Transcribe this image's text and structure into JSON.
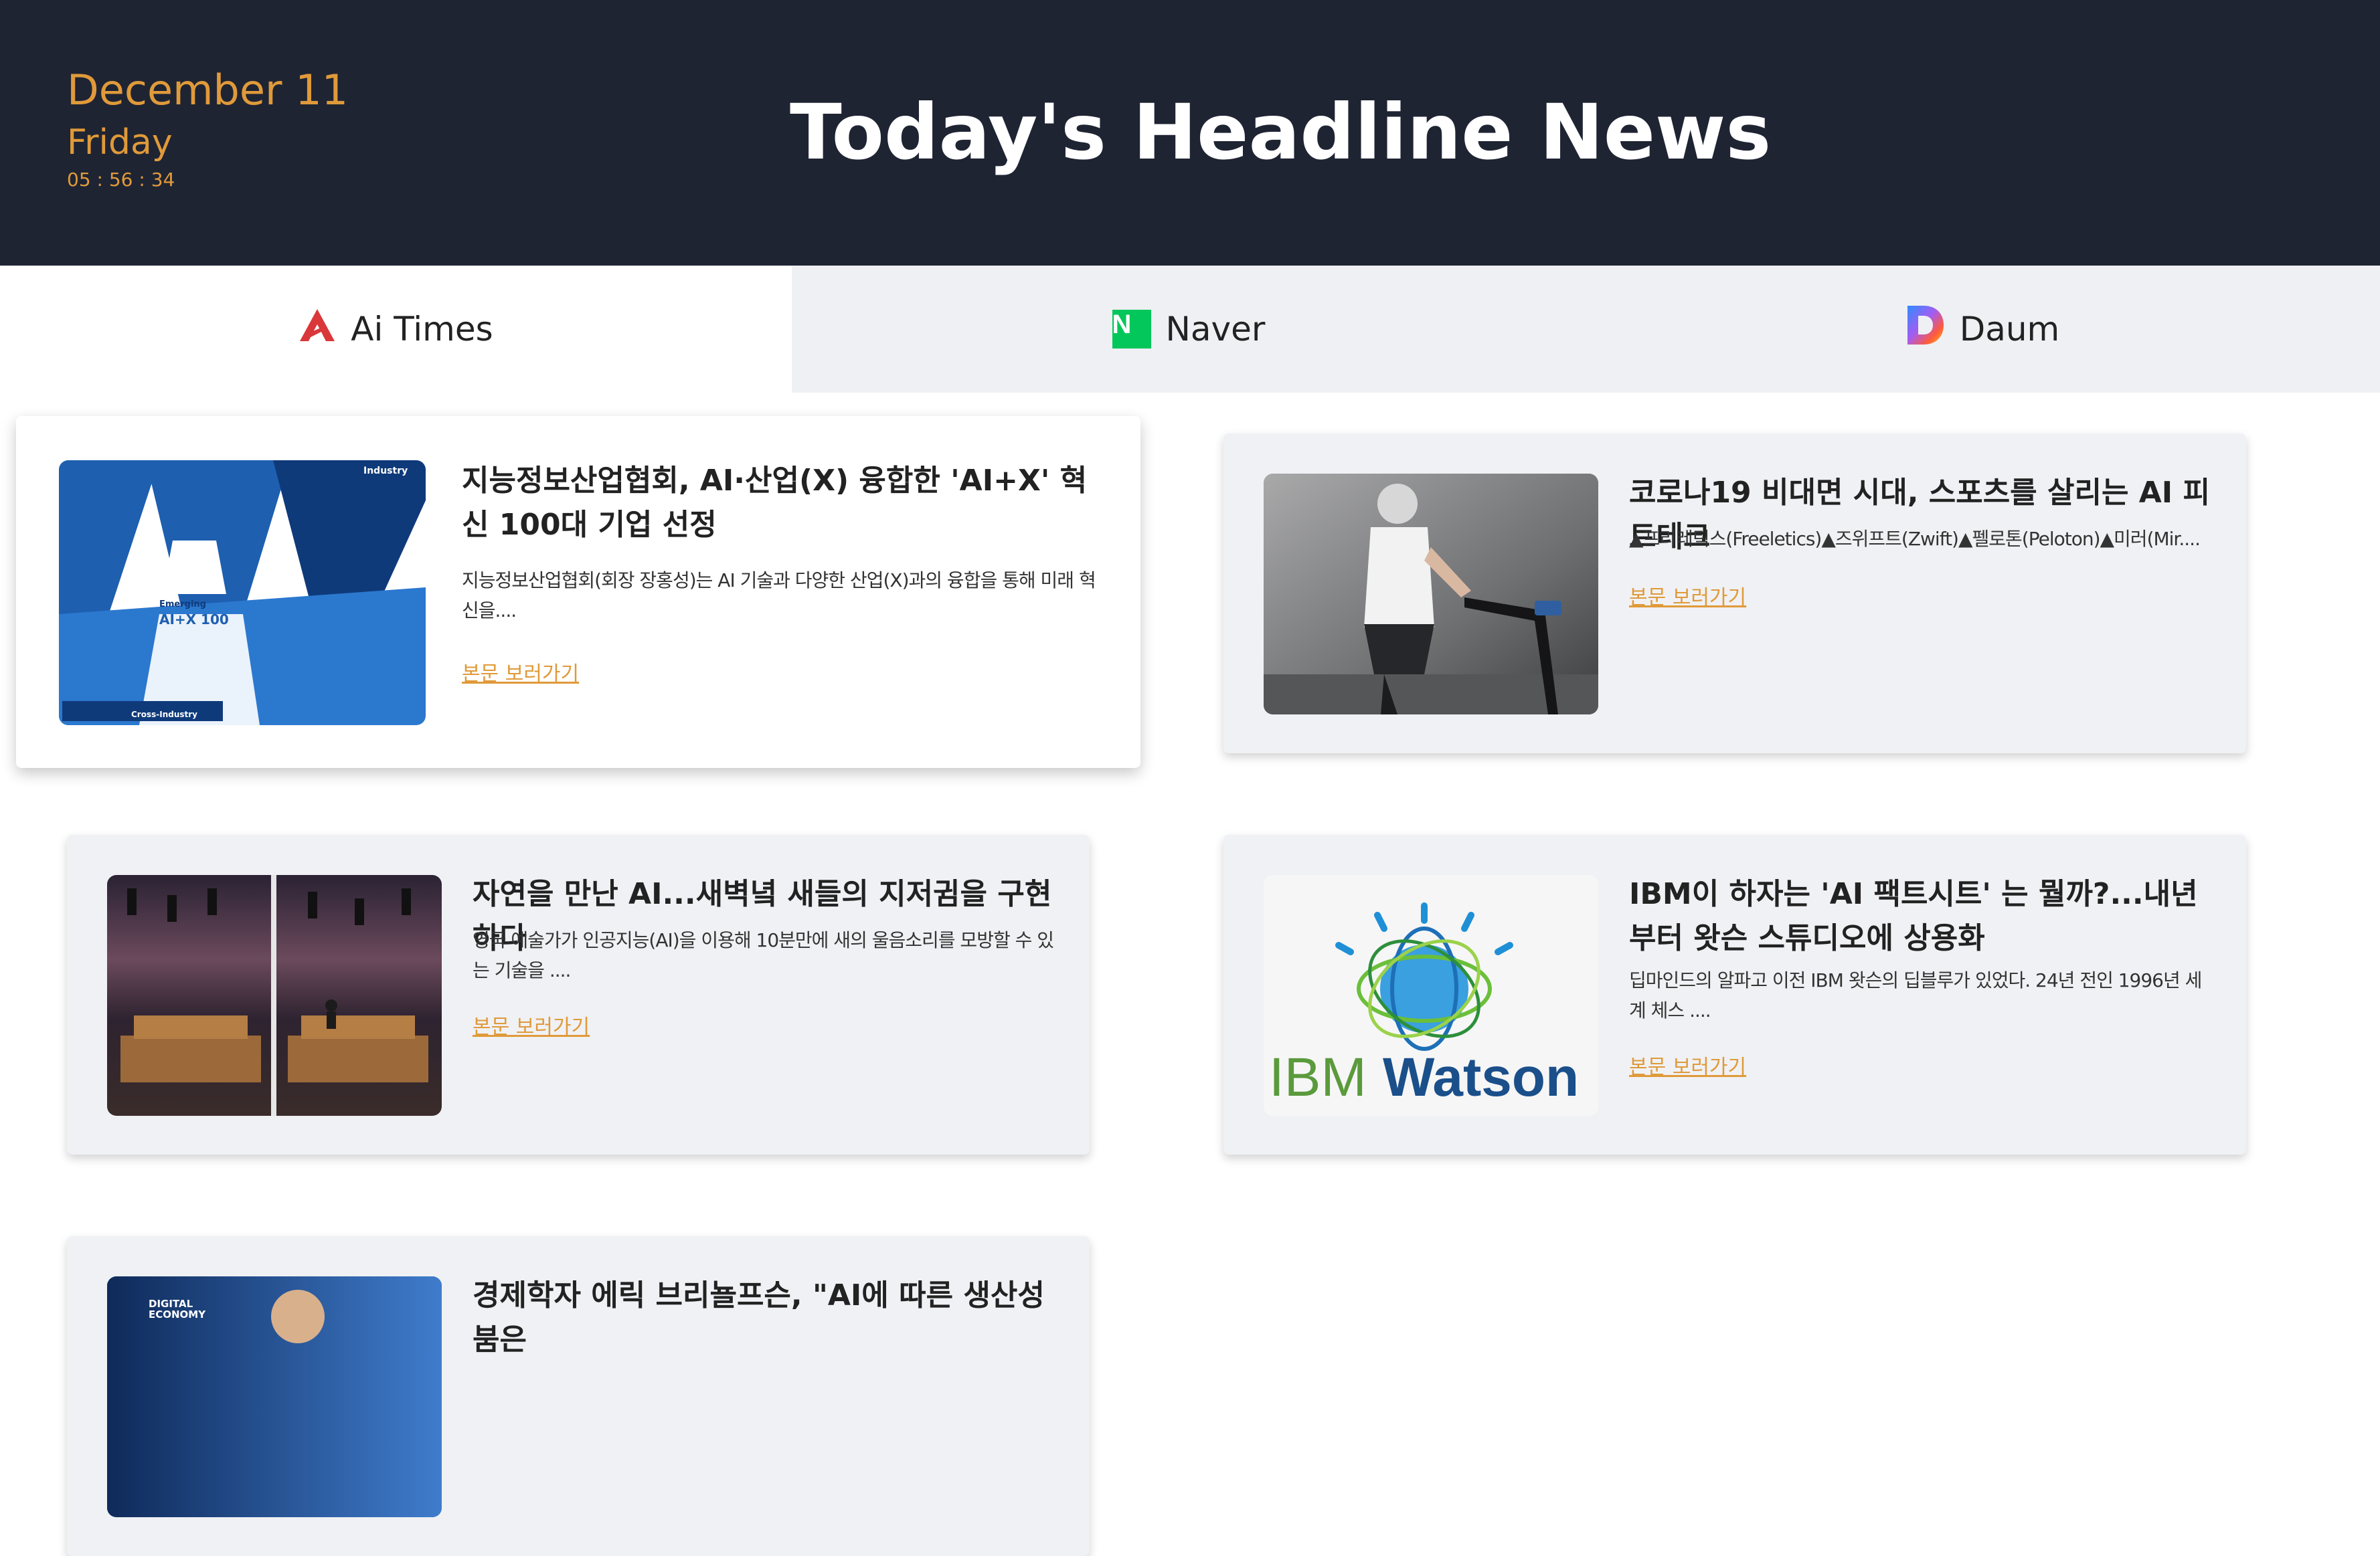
{
  "header": {
    "date": "December 11",
    "day": "Friday",
    "time": "05 : 56 : 34",
    "title": "Today's Headline News"
  },
  "tabs": [
    {
      "label": "Ai Times",
      "icon": "ai-times-logo-icon",
      "active": true
    },
    {
      "label": "Naver",
      "icon": "naver-logo-icon",
      "icon_text": "N",
      "active": false
    },
    {
      "label": "Daum",
      "icon": "daum-logo-icon",
      "active": false
    }
  ],
  "colors": {
    "header_bg": "#1f2433",
    "accent": "#e09a3a",
    "tab_bar_bg": "#eff0f4",
    "naver_green": "#03c75a",
    "ai_times_red": "#d9373a"
  },
  "articles": [
    {
      "title": "지능정보산업협회, AI·산업(X) 융합한 'AI+X' 혁신 100대 기업 선정",
      "summary": "지능정보산업협회(회장 장홍성)는 AI 기술과 다양한 산업(X)과의 융합을 통해 미래 혁신을....",
      "link_label": "본문 보러가기",
      "image_text": {
        "industry": "Industry",
        "emerging": "Emerging",
        "aix": "AI+X 100",
        "cross": "Cross-Industry"
      }
    },
    {
      "title": "코로나19 비대면 시대, 스포츠를 살리는 AI 피트테크",
      "summary": "▲프리레틱스(Freeletics)▲즈위프트(Zwift)▲펠로톤(Peloton)▲미러(Mir....",
      "link_label": "본문 보러가기"
    },
    {
      "title": "자연을 만난 AI...새벽녘 새들의 지저귐을 구현하다",
      "summary": "영국 예술가가 인공지능(AI)을 이용해 10분만에 새의 울음소리를 모방할 수 있는 기술을 ....",
      "link_label": "본문 보러가기"
    },
    {
      "title": "IBM이 하자는 'AI 팩트시트' 는 뭘까?...내년부터 왓슨 스튜디오에 상용화",
      "summary": "딥마인드의 알파고 이전 IBM 왓슨의 딥블루가 있었다. 24년 전인 1996년 세계 체스 ....",
      "link_label": "본문 보러가기",
      "image_text": {
        "brand": "IBM",
        "product": "Watson"
      }
    },
    {
      "title": "경제학자 에릭 브리뇰프슨, \"AI에 따른 생산성 붐은",
      "image_text": {
        "line1": "DIGITAL",
        "line2": "ECONOMY"
      }
    }
  ]
}
